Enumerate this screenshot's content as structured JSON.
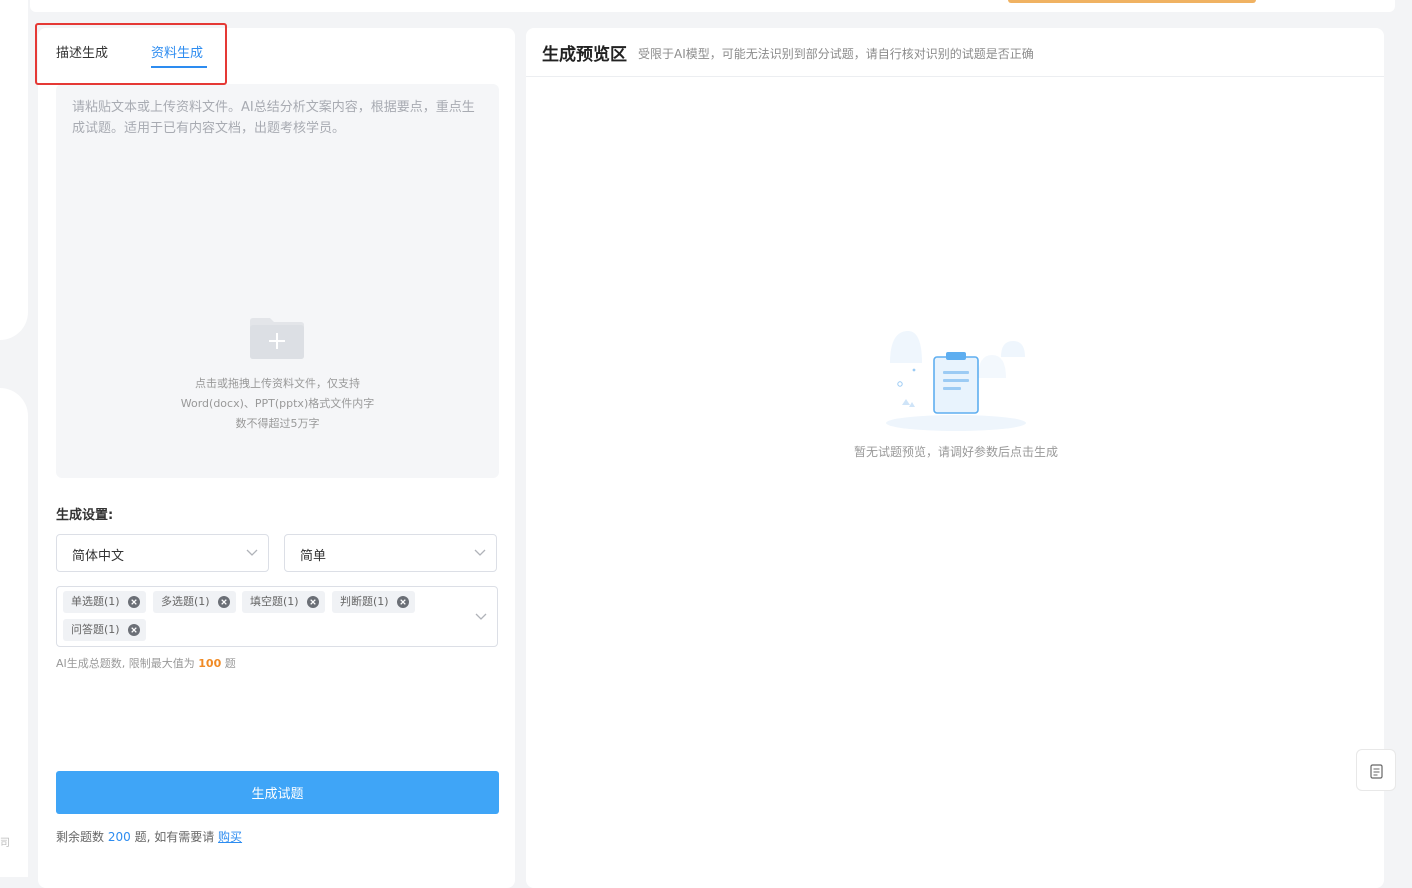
{
  "tabs": [
    {
      "label": "描述生成",
      "active": false
    },
    {
      "label": "资料生成",
      "active": true
    }
  ],
  "input": {
    "placeholder": "请粘贴文本或上传资料文件。AI总结分析文案内容，根据要点，重点生成试题。适用于已有内容文档，出题考核学员。"
  },
  "upload": {
    "icon": "folder-plus-icon",
    "line1": "点击或拖拽上传资料文件，仅支持",
    "line2": "Word(docx)、PPT(pptx)格式文件内字",
    "line3": "数不得超过5万字"
  },
  "settings": {
    "label": "生成设置:",
    "language": "简体中文",
    "difficulty": "简单",
    "question_types": [
      "单选题(1)",
      "多选题(1)",
      "填空题(1)",
      "判断题(1)",
      "问答题(1)"
    ],
    "hint_prefix": "AI生成总题数, 限制最大值为",
    "hint_max": "100",
    "hint_suffix": "题"
  },
  "generate_button": "生成试题",
  "remaining": {
    "prefix": "剩余题数",
    "count": "200",
    "middle": "题, 如有需要请",
    "buy_link": "购买"
  },
  "preview": {
    "title": "生成预览区",
    "subtitle": "受限于AI模型，可能无法识别到部分试题，请自行核对识别的试题是否正确",
    "empty_icon": "clipboard-empty-icon",
    "empty_text": "暂无试题预览，请调好参数后点击生成"
  },
  "float_button": {
    "icon": "document-icon"
  },
  "left_edge_text": "司",
  "colors": {
    "accent": "#2d8cf0",
    "button": "#3fa5f7",
    "warning": "#f08a24",
    "highlight": "#e53935"
  }
}
